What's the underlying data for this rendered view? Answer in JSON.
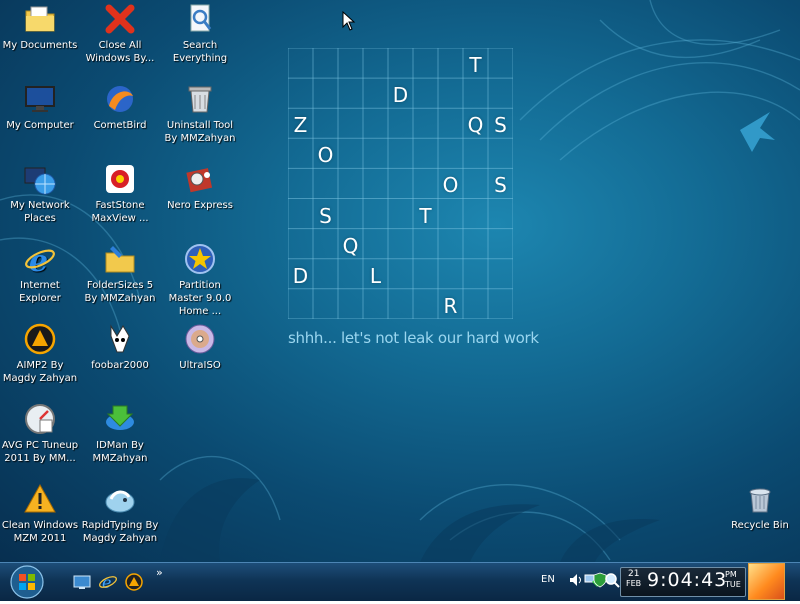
{
  "desktop": {
    "icons": [
      {
        "label": "My Documents",
        "icon": "folder-documents-icon"
      },
      {
        "label": "Close All Windows By...",
        "icon": "red-x-icon"
      },
      {
        "label": "Search Everything",
        "icon": "search-document-icon"
      },
      {
        "label": "My Computer",
        "icon": "monitor-icon"
      },
      {
        "label": "CometBird",
        "icon": "cometbird-icon"
      },
      {
        "label": "Uninstall Tool By MMZahyan",
        "icon": "trash-bin-icon"
      },
      {
        "label": "My Network Places",
        "icon": "network-globe-icon"
      },
      {
        "label": "FastStone MaxView ...",
        "icon": "faststone-icon"
      },
      {
        "label": "Nero Express",
        "icon": "nero-icon"
      },
      {
        "label": "Internet Explorer",
        "icon": "internet-explorer-icon"
      },
      {
        "label": "FolderSizes 5 By MMZahyan",
        "icon": "folder-sizes-icon"
      },
      {
        "label": "Partition Master 9.0.0 Home ...",
        "icon": "partition-star-icon"
      },
      {
        "label": "AIMP2 By Magdy Zahyan",
        "icon": "aimp-icon"
      },
      {
        "label": "foobar2000",
        "icon": "foobar-icon"
      },
      {
        "label": "UltraISO",
        "icon": "disc-icon"
      },
      {
        "label": "AVG PC Tuneup 2011 By MM...",
        "icon": "gauge-icon"
      },
      {
        "label": "IDMan By MMZahyan",
        "icon": "download-manager-icon"
      },
      {
        "label": "Clean Windows MZM 2011",
        "icon": "warning-triangle-icon"
      },
      {
        "label": "RapidTyping By Magdy Zahyan",
        "icon": "rapidtyping-icon"
      },
      {
        "label": "Recycle Bin",
        "icon": "recycle-bin-icon"
      }
    ],
    "grid_letters": [
      {
        "ch": "T"
      },
      {
        "ch": "D"
      },
      {
        "ch": "Z"
      },
      {
        "ch": "Q"
      },
      {
        "ch": "S"
      },
      {
        "ch": "O"
      },
      {
        "ch": "O"
      },
      {
        "ch": "S"
      },
      {
        "ch": "S"
      },
      {
        "ch": "T"
      },
      {
        "ch": "Q"
      },
      {
        "ch": "D"
      },
      {
        "ch": "L"
      },
      {
        "ch": "R"
      }
    ],
    "tagline": "shhh... let's not leak our hard work"
  },
  "taskbar": {
    "start_icon": "windows-logo-icon",
    "quick_launch": [
      "show-desktop-icon",
      "internet-explorer-icon",
      "aimp-icon"
    ],
    "overflow": "»",
    "language": "EN",
    "tray_icons": [
      "speaker-icon",
      "network-icon",
      "shield-icon",
      "search-icon"
    ],
    "clock": {
      "day": "21",
      "month": "FEB",
      "time": "9:04:43",
      "ampm": "PM",
      "weekday": "TUE"
    }
  },
  "colors": {
    "accent": "#1d86b0",
    "taskbar": "#0f3456",
    "tagline": "#9ad6ef"
  }
}
